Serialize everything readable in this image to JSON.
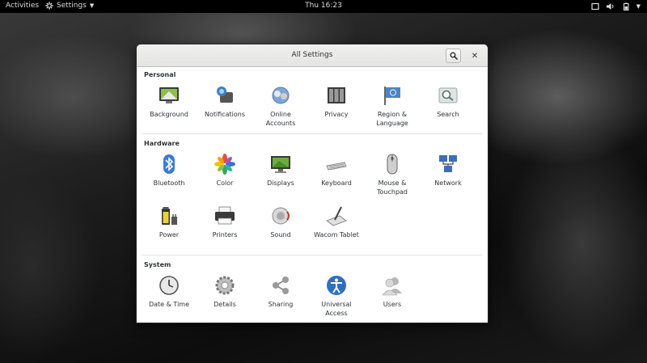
{
  "topbar": {
    "activities": "Activities",
    "app_menu": "Settings",
    "clock": "Thu 16:23"
  },
  "window": {
    "title": "All Settings"
  },
  "sections": {
    "personal": {
      "title": "Personal",
      "items": [
        "Background",
        "Notifications",
        "Online\nAccounts",
        "Privacy",
        "Region &\nLanguage",
        "Search"
      ]
    },
    "hardware": {
      "title": "Hardware",
      "items": [
        "Bluetooth",
        "Color",
        "Displays",
        "Keyboard",
        "Mouse &\nTouchpad",
        "Network",
        "Power",
        "Printers",
        "Sound",
        "Wacom Tablet"
      ]
    },
    "system": {
      "title": "System",
      "items": [
        "Date & Time",
        "Details",
        "Sharing",
        "Universal\nAccess",
        "Users"
      ]
    }
  },
  "colors": {
    "topbar": "#000000",
    "window_bg": "#ffffff",
    "accent_blue": "#3465a4"
  }
}
